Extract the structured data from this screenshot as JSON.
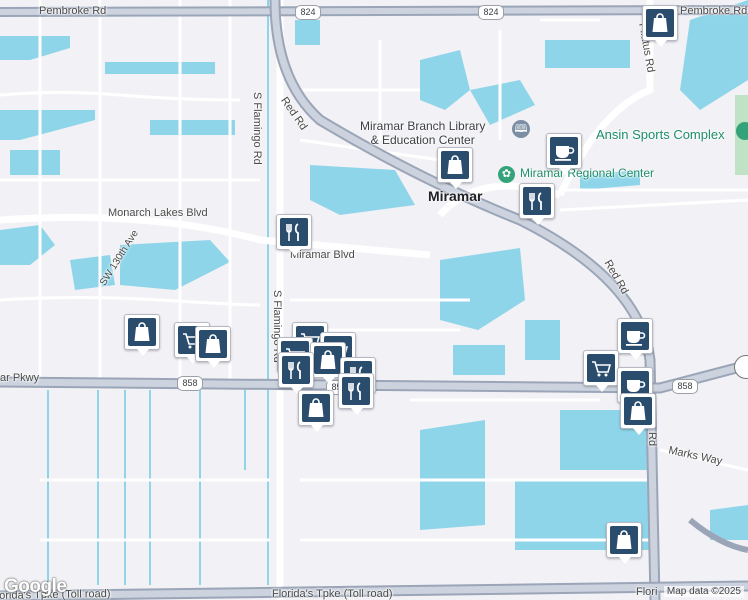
{
  "map": {
    "labels": {
      "pembroke_rd_left": "Pembroke Rd",
      "pembroke_rd_right": "Pembroke Rd",
      "flamingo_rd_upper": "S Flamingo Rd",
      "flamingo_rd_lower": "S Flamingo Rd",
      "red_rd_upper": "Red Rd",
      "red_rd_lower": "Red Rd",
      "red_rd_bottom": "Rd",
      "pilatus_rd": "Pilatus Rd",
      "monarch_lakes_blvd": "Monarch Lakes Blvd",
      "miramar_blvd": "Miramar Blvd",
      "sw130th_ave": "SW 130th Ave",
      "miramar_pkwy": "ar Pkwy",
      "marks_way": "Marks Way",
      "florida_tpke": "Florida's Tpke (Toll road)",
      "florida_tpke_left": "Florida's Tpke (Toll road)",
      "florida_right": "Flori",
      "library": "Miramar Branch Library\n& Education Center",
      "sports_complex": "Ansin Sports Complex",
      "miramar_city": "Miramar",
      "regional_center": "Miramar Regional Center"
    },
    "shields": [
      "824",
      "824",
      "858",
      "858",
      "858"
    ],
    "footer": {
      "attribution": "Map data ©2025",
      "logo": "Google"
    },
    "colors": {
      "water": "#8fd5ea",
      "land": "#f2f1f5",
      "road": "#ffffff",
      "highway": "#9aa5b7",
      "pin": "#2a4d6e",
      "park": "#bfe3c4"
    },
    "pins": [
      {
        "icon": "shopping-bag-icon"
      },
      {
        "icon": "shopping-bag-icon"
      },
      {
        "icon": "coffee-cup-icon"
      },
      {
        "icon": "restaurant-icon"
      },
      {
        "icon": "restaurant-icon"
      },
      {
        "icon": "shopping-bag-icon"
      },
      {
        "icon": "shopping-cart-icon"
      },
      {
        "icon": "shopping-bag-icon"
      },
      {
        "icon": "shopping-cart-icon"
      },
      {
        "icon": "shopping-cart-icon"
      },
      {
        "icon": "shopping-cart-icon"
      },
      {
        "icon": "shopping-bag-icon"
      },
      {
        "icon": "restaurant-icon"
      },
      {
        "icon": "restaurant-icon"
      },
      {
        "icon": "shopping-bag-icon"
      },
      {
        "icon": "restaurant-icon"
      },
      {
        "icon": "coffee-cup-icon"
      },
      {
        "icon": "shopping-cart-icon"
      },
      {
        "icon": "coffee-cup-icon"
      },
      {
        "icon": "shopping-bag-icon"
      },
      {
        "icon": "shopping-bag-icon"
      }
    ]
  }
}
